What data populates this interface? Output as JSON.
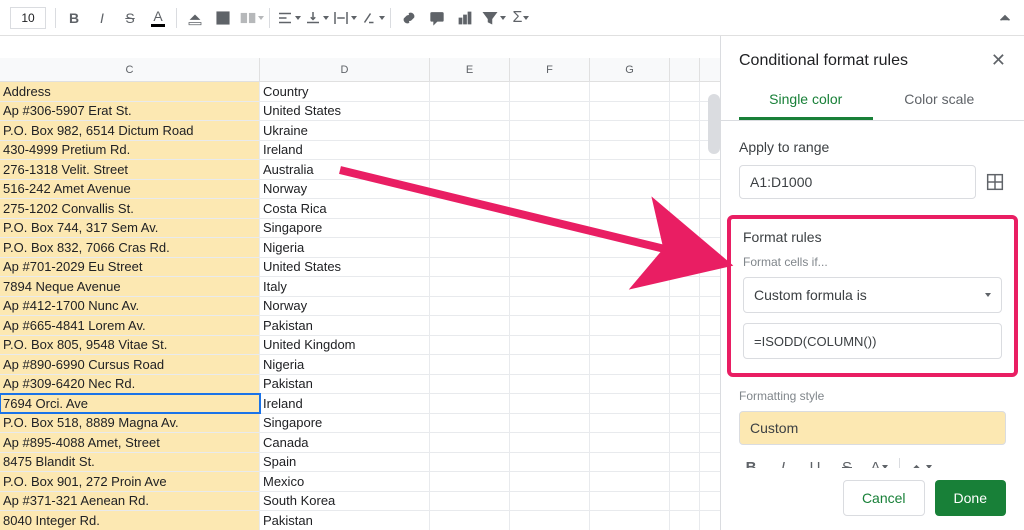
{
  "toolbar": {
    "font_size": "10"
  },
  "columns": [
    "C",
    "D",
    "E",
    "F",
    "G"
  ],
  "rows": [
    {
      "c": "Address",
      "d": "Country"
    },
    {
      "c": "Ap #306-5907 Erat St.",
      "d": "United States"
    },
    {
      "c": "P.O. Box 982, 6514 Dictum Road",
      "d": "Ukraine"
    },
    {
      "c": "430-4999 Pretium Rd.",
      "d": "Ireland"
    },
    {
      "c": "276-1318 Velit. Street",
      "d": "Australia"
    },
    {
      "c": "516-242 Amet Avenue",
      "d": "Norway"
    },
    {
      "c": "275-1202 Convallis St.",
      "d": "Costa Rica"
    },
    {
      "c": "P.O. Box 744, 317 Sem Av.",
      "d": "Singapore"
    },
    {
      "c": "P.O. Box 832, 7066 Cras Rd.",
      "d": "Nigeria"
    },
    {
      "c": "Ap #701-2029 Eu Street",
      "d": "United States"
    },
    {
      "c": "7894 Neque Avenue",
      "d": "Italy"
    },
    {
      "c": "Ap #412-1700 Nunc Av.",
      "d": "Norway"
    },
    {
      "c": "Ap #665-4841 Lorem Av.",
      "d": "Pakistan"
    },
    {
      "c": "P.O. Box 805, 9548 Vitae St.",
      "d": "United Kingdom"
    },
    {
      "c": "Ap #890-6990 Cursus Road",
      "d": "Nigeria"
    },
    {
      "c": "Ap #309-6420 Nec Rd.",
      "d": "Pakistan"
    },
    {
      "c": "7694 Orci. Ave",
      "d": "Ireland",
      "active": true
    },
    {
      "c": "P.O. Box 518, 8889 Magna Av.",
      "d": "Singapore"
    },
    {
      "c": "Ap #895-4088 Amet, Street",
      "d": "Canada"
    },
    {
      "c": "8475 Blandit St.",
      "d": "Spain"
    },
    {
      "c": "P.O. Box 901, 272 Proin Ave",
      "d": "Mexico"
    },
    {
      "c": "Ap #371-321 Aenean Rd.",
      "d": "South Korea"
    },
    {
      "c": "8040 Integer Rd.",
      "d": "Pakistan"
    }
  ],
  "sidebar": {
    "title": "Conditional format rules",
    "tabs": {
      "single": "Single color",
      "scale": "Color scale"
    },
    "apply_label": "Apply to range",
    "range_value": "A1:D1000",
    "rules_label": "Format rules",
    "cells_if_label": "Format cells if...",
    "condition_value": "Custom formula is",
    "formula_value": "=ISODD(COLUMN())",
    "style_label": "Formatting style",
    "style_preview": "Custom",
    "cancel": "Cancel",
    "done": "Done"
  }
}
